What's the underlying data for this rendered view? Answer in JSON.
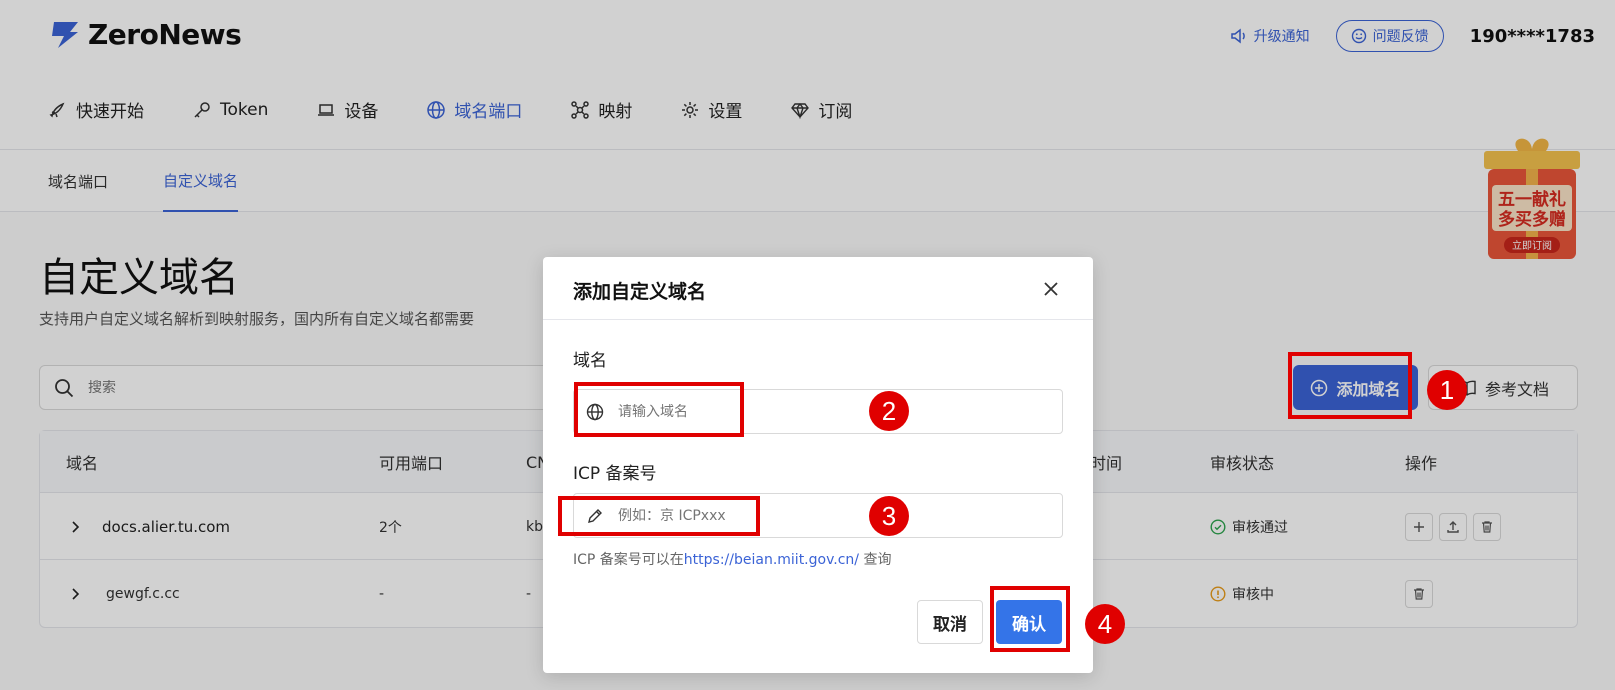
{
  "header": {
    "logo_text": "ZeroNews",
    "notice_label": "升级通知",
    "feedback_label": "问题反馈",
    "phone": "190****1783"
  },
  "nav": {
    "items": [
      {
        "label": "快速开始",
        "icon": "rocket-icon"
      },
      {
        "label": "Token",
        "icon": "key-icon"
      },
      {
        "label": "设备",
        "icon": "laptop-icon"
      },
      {
        "label": "域名端口",
        "icon": "globe-icon"
      },
      {
        "label": "映射",
        "icon": "network-icon"
      },
      {
        "label": "设置",
        "icon": "gear-icon"
      },
      {
        "label": "订阅",
        "icon": "diamond-icon"
      }
    ],
    "active_index": 3
  },
  "subnav": {
    "tabs": [
      {
        "label": "域名端口"
      },
      {
        "label": "自定义域名"
      }
    ],
    "active_index": 1
  },
  "main": {
    "title": "自定义域名",
    "description": "支持用户自定义域名解析到映射服务，国内所有自定义域名都需要",
    "search_placeholder": "搜索",
    "add_button_label": "添加域名",
    "doc_button_label": "参考文档"
  },
  "table": {
    "columns": [
      "域名",
      "可用端口",
      "CN",
      "时间",
      "审核状态",
      "操作"
    ],
    "rows": [
      {
        "domain": "docs.alier.tu.com",
        "ports": "2个",
        "cname": "kb",
        "status": "审核通过",
        "status_color": "#2ea44f"
      },
      {
        "domain": "gewgf.c.cc",
        "ports": "-",
        "cname": "-",
        "status": "审核中",
        "status_color": "#e89b1a"
      }
    ]
  },
  "promo": {
    "line1": "五一献礼",
    "line2": "多买多赠",
    "button": "立即订阅"
  },
  "modal": {
    "title": "添加自定义域名",
    "domain_label": "域名",
    "domain_placeholder": "请输入域名",
    "icp_label": "ICP 备案号",
    "icp_placeholder": "例如：京 ICPxxx",
    "hint_prefix": "ICP 备案号可以在",
    "hint_link": "https://beian.miit.gov.cn/",
    "hint_suffix": " 查询",
    "cancel_label": "取消",
    "confirm_label": "确认"
  },
  "annotations": [
    "1",
    "2",
    "3",
    "4"
  ],
  "colors": {
    "accent": "#3b63d6",
    "confirm": "#3474e8",
    "annotation_red": "#e00000"
  }
}
